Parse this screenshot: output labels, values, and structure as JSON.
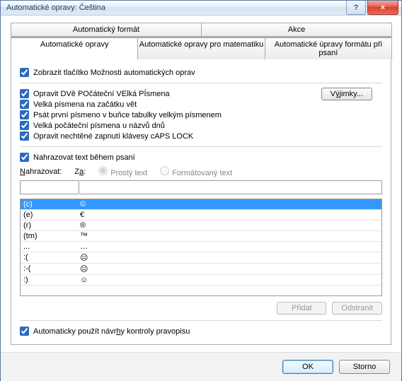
{
  "title": "Automatické opravy: Čeština",
  "winbuttons": {
    "help": "?",
    "close": "×"
  },
  "tabs_row1": [
    {
      "label": "Automatický formát"
    },
    {
      "label": "Akce"
    }
  ],
  "tabs_row2": [
    {
      "label": "Automatické opravy"
    },
    {
      "label": "Automatické opravy pro matematiku"
    },
    {
      "label": "Automatické úpravy formátu při psaní"
    }
  ],
  "checks": {
    "show_button": "Zobrazit tlačítko Možnosti automatických oprav",
    "two_initial": "Opravit DVě POčáteční VElká PÍsmena",
    "sentence": "Velká písmena na začátku vět",
    "tablecell": "Psát první písmeno v buňce tabulky velkým písmenem",
    "daynames": "Velká počáteční písmena u názvů dnů",
    "capslock": "Opravit nechtěné zapnutí klávesy cAPS LOCK",
    "replace_typing": "Nahrazovat text během psaní",
    "autospell": "Automaticky použít návrhy kontroly pravopisu"
  },
  "exceptions_btn": "Výjimky...",
  "replace_label": "Nahrazovat:",
  "with_label": "Za:",
  "radio_plain": "Prostý text",
  "radio_formatted": "Formátovaný text",
  "list": [
    {
      "from": "(c)",
      "to": "©",
      "selected": true
    },
    {
      "from": "(e)",
      "to": "€"
    },
    {
      "from": "(r)",
      "to": "®"
    },
    {
      "from": "(tm)",
      "to": "™"
    },
    {
      "from": "...",
      "to": "…"
    },
    {
      "from": ":(",
      "to": "☹"
    },
    {
      "from": ":-(",
      "to": "☹"
    },
    {
      "from": ":)",
      "to": "☺"
    }
  ],
  "add_btn": "Přidat",
  "delete_btn": "Odstranit",
  "ok_btn": "OK",
  "cancel_btn": "Storno"
}
